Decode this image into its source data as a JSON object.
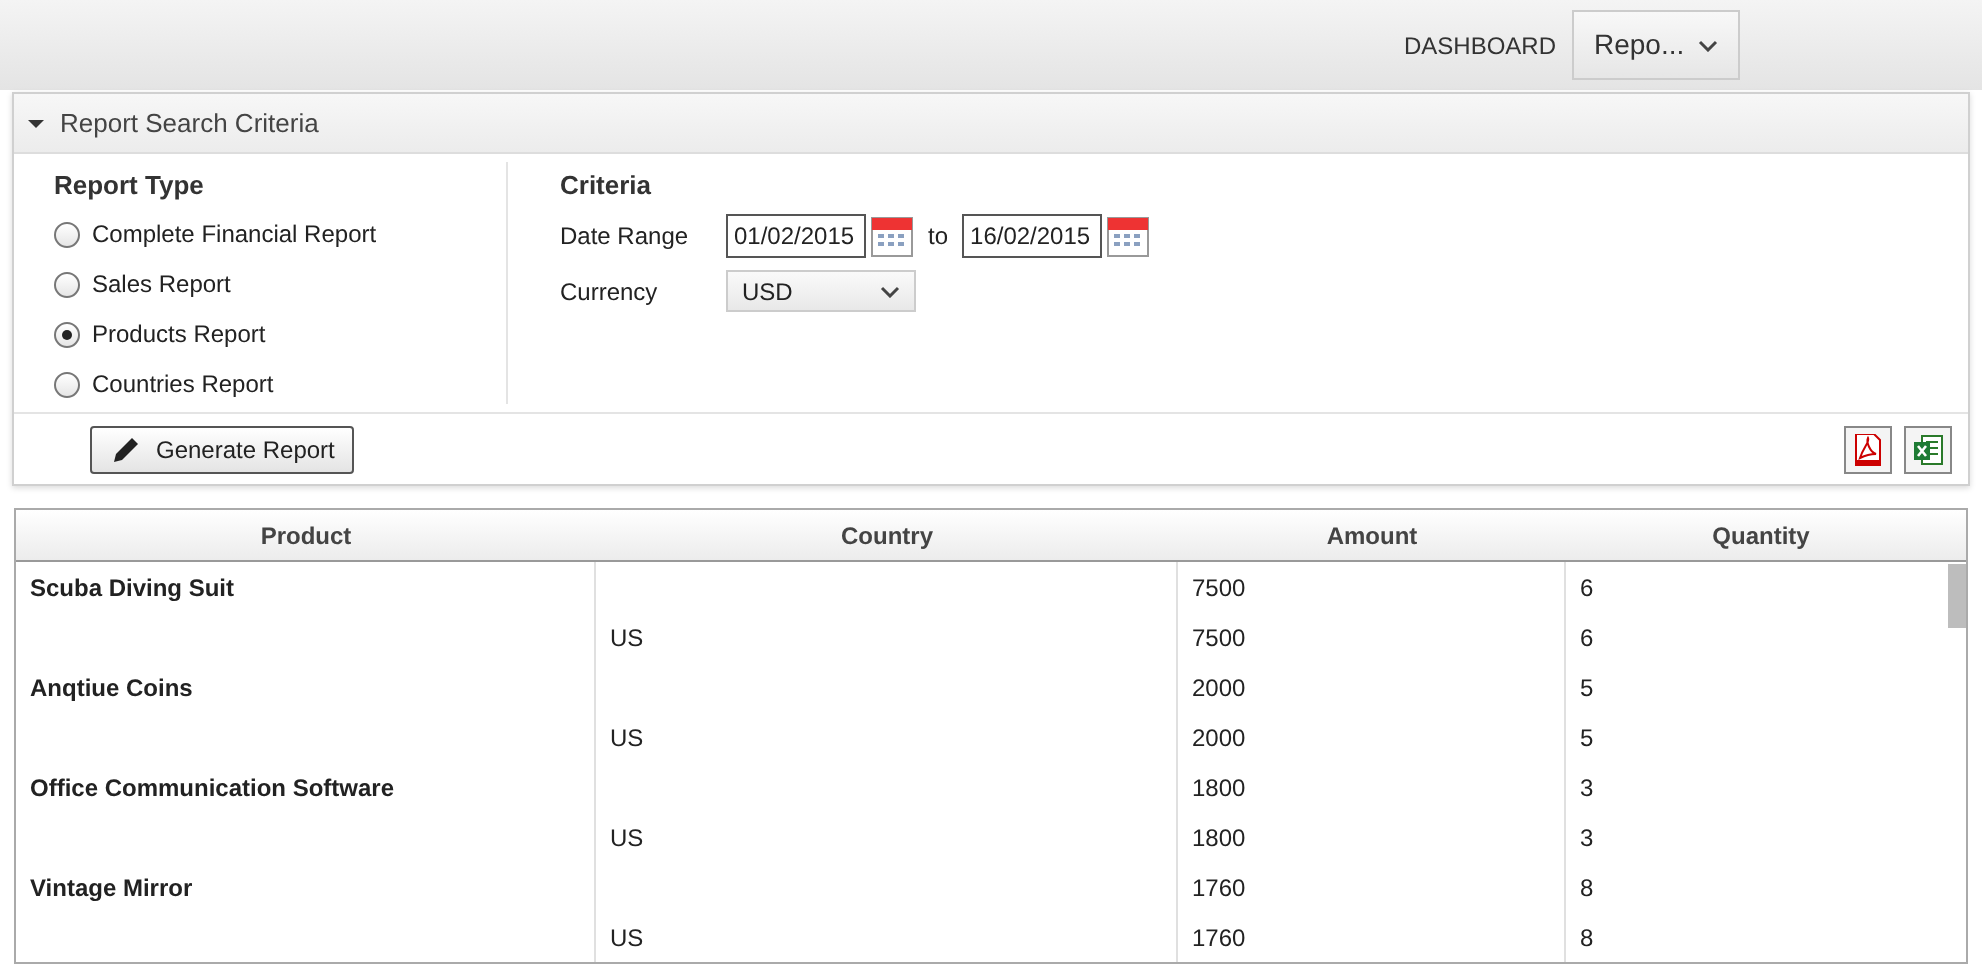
{
  "top_bar": {
    "dashboard_label": "DASHBOARD",
    "menu_value": "Repo..."
  },
  "panel": {
    "title": "Report Search Criteria",
    "expanded": true,
    "report_type": {
      "heading": "Report Type",
      "options": [
        {
          "label": "Complete Financial Report",
          "selected": false
        },
        {
          "label": "Sales Report",
          "selected": false
        },
        {
          "label": "Products Report",
          "selected": true
        },
        {
          "label": "Countries Report",
          "selected": false
        }
      ]
    },
    "criteria": {
      "heading": "Criteria",
      "date_range_label": "Date Range",
      "date_from": "01/02/2015",
      "to_label": "to",
      "date_to": "16/02/2015",
      "currency_label": "Currency",
      "currency_value": "USD"
    },
    "generate_button": "Generate Report"
  },
  "table": {
    "columns": [
      "Product",
      "Country",
      "Amount",
      "Quantity"
    ],
    "rows": [
      {
        "kind": "product",
        "cells": [
          "Scuba Diving Suit",
          "",
          "7500",
          "6"
        ]
      },
      {
        "kind": "country",
        "cells": [
          "",
          "US",
          "7500",
          "6"
        ]
      },
      {
        "kind": "product",
        "cells": [
          "Anqtiue Coins",
          "",
          "2000",
          "5"
        ]
      },
      {
        "kind": "country",
        "cells": [
          "",
          "US",
          "2000",
          "5"
        ]
      },
      {
        "kind": "product",
        "cells": [
          "Office Communication Software",
          "",
          "1800",
          "3"
        ]
      },
      {
        "kind": "country",
        "cells": [
          "",
          "US",
          "1800",
          "3"
        ]
      },
      {
        "kind": "product",
        "cells": [
          "Vintage Mirror",
          "",
          "1760",
          "8"
        ]
      },
      {
        "kind": "country",
        "cells": [
          "",
          "US",
          "1760",
          "8"
        ]
      }
    ]
  }
}
